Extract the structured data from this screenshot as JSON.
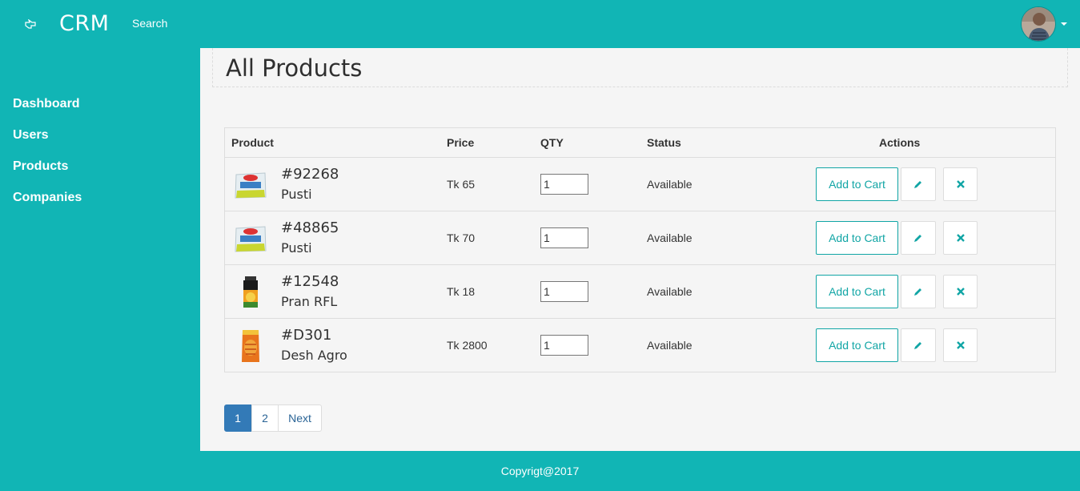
{
  "header": {
    "brand": "CRM",
    "search_label": "Search",
    "toggle_icon": "hand-pointer-icon",
    "avatar_icon": "user-avatar"
  },
  "sidebar": {
    "items": [
      {
        "label": "Dashboard"
      },
      {
        "label": "Users"
      },
      {
        "label": "Products"
      },
      {
        "label": "Companies"
      }
    ]
  },
  "main": {
    "title": "All Products",
    "columns": {
      "product": "Product",
      "price": "Price",
      "qty": "QTY",
      "status": "Status",
      "actions": "Actions"
    },
    "rows": [
      {
        "id": "#92268",
        "name": "Pusti",
        "price": "Tk 65",
        "qty": "1",
        "status": "Available",
        "cart_label": "Add to Cart",
        "thumb": "pusti-pack"
      },
      {
        "id": "#48865",
        "name": "Pusti",
        "price": "Tk 70",
        "qty": "1",
        "status": "Available",
        "cart_label": "Add to Cart",
        "thumb": "pusti-pack"
      },
      {
        "id": "#12548",
        "name": "Pran RFL",
        "price": "Tk 18",
        "qty": "1",
        "status": "Available",
        "cart_label": "Add to Cart",
        "thumb": "juice-bottle"
      },
      {
        "id": "#D301",
        "name": "Desh Agro",
        "price": "Tk 2800",
        "qty": "1",
        "status": "Available",
        "cart_label": "Add to Cart",
        "thumb": "snack-pack"
      }
    ],
    "pagination": {
      "pages": [
        "1",
        "2"
      ],
      "active": "1",
      "next_label": "Next"
    }
  },
  "footer": {
    "text": "Copyrigt@2017"
  },
  "colors": {
    "teal": "#11b5b5",
    "content_bg": "#f5f5f5",
    "active_page": "#337ab7"
  }
}
